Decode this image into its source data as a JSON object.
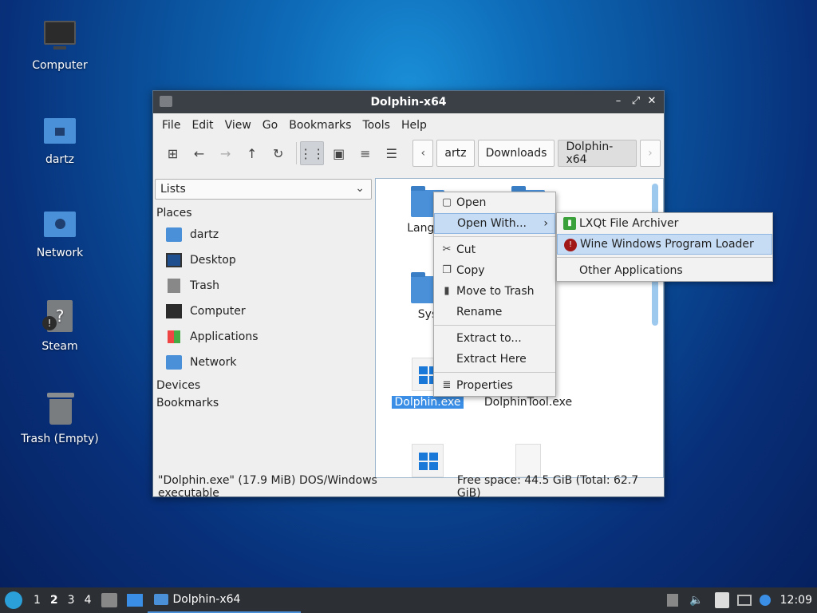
{
  "desktop": {
    "icons": [
      {
        "label": "Computer"
      },
      {
        "label": "dartz"
      },
      {
        "label": "Network"
      },
      {
        "label": "Steam"
      },
      {
        "label": "Trash (Empty)"
      }
    ]
  },
  "window": {
    "title": "Dolphin-x64",
    "menu": [
      "File",
      "Edit",
      "View",
      "Go",
      "Bookmarks",
      "Tools",
      "Help"
    ],
    "breadcrumbs": [
      "artz",
      "Downloads",
      "Dolphin-x64"
    ],
    "view_mode": "Lists",
    "places_heading": "Places",
    "places": [
      "dartz",
      "Desktop",
      "Trash",
      "Computer",
      "Applications",
      "Network"
    ],
    "devices_heading": "Devices",
    "bookmarks_heading": "Bookmarks",
    "files": [
      {
        "name": "Langua"
      },
      {
        "name": "Sys"
      },
      {
        "name": "xt"
      },
      {
        "name": "Dolphin.exe"
      },
      {
        "name": "DolphinTool.exe"
      }
    ],
    "status_left": "\"Dolphin.exe\" (17.9 MiB) DOS/Windows executable",
    "status_right": "Free space: 44.5 GiB (Total: 62.7 GiB)"
  },
  "context_menu": {
    "items": [
      "Open",
      "Open With...",
      "Cut",
      "Copy",
      "Move to Trash",
      "Rename",
      "Extract to...",
      "Extract Here",
      "Properties"
    ]
  },
  "submenu": {
    "items": [
      "LXQt File Archiver",
      "Wine Windows Program Loader",
      "Other Applications"
    ]
  },
  "taskbar": {
    "workspaces": [
      "1",
      "2",
      "3",
      "4"
    ],
    "task_label": "Dolphin-x64",
    "clock": "12:09"
  }
}
